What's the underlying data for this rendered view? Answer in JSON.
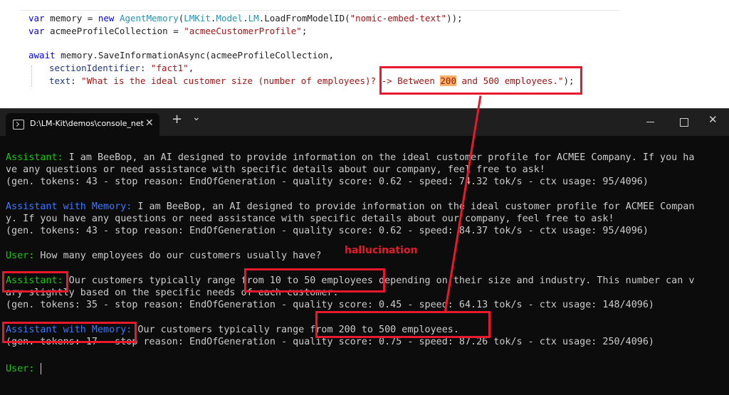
{
  "code": {
    "line1": {
      "p1": "var",
      "p2": " memory = ",
      "p3": "new",
      "p4": " ",
      "p5": "AgentMemory",
      "p6": "(",
      "p7": "LMKit",
      "p8": ".",
      "p9": "Model",
      "p10": ".",
      "p11": "LM",
      "p12": ".LoadFromModelID(",
      "p13": "\"nomic-embed-text\"",
      "p14": "));"
    },
    "line2": {
      "p1": "var",
      "p2": " acmeeProfileCollection = ",
      "p3": "\"acmeeCustomerProfile\"",
      "p4": ";"
    },
    "line3": {
      "p1": "await",
      "p2": " memory.SaveInformationAsync(acmeeProfileCollection,"
    },
    "line4": {
      "p1": "sectionIdentifier",
      "p2": ": ",
      "p3": "\"fact1\"",
      "p4": ","
    },
    "line5": {
      "p1": "text",
      "p2": ": ",
      "p3": "\"What is the ideal customer size (number of employees)? -> Between ",
      "p4": "200",
      "p5": " and 500 employees.\"",
      "p6": ");"
    }
  },
  "terminal": {
    "tab_title": "D:\\LM-Kit\\demos\\console_net",
    "tab_close": "✕",
    "new_tab": "+",
    "dropdown": "⌄",
    "window_close": "✕",
    "lines": {
      "l1a": "Assistant:",
      "l1b": " I am BeeBop, an AI designed to provide information on the ideal customer profile for ACMEE Company. If you ha",
      "l2": "ve any questions or need assistance with specific details about our company, feel free to ask!",
      "l3": "(gen. tokens: 43 - stop reason: EndOfGeneration - quality score: 0.62 - speed: 74.32 tok/s - ctx usage: 95/4096)",
      "l4a": "Assistant with Memory:",
      "l4b": " I am BeeBop, an AI designed to provide information on the ideal customer profile for ACMEE Compan",
      "l5": "y. If you have any questions or need assistance with specific details about our company, feel free to ask!",
      "l6": "(gen. tokens: 43 - stop reason: EndOfGeneration - quality score: 0.62 - speed: 84.37 tok/s - ctx usage: 95/4096)",
      "l7a": "User:",
      "l7b": " How many employees do our customers usually have?",
      "l8a": "Assistant:",
      "l8b": " Our customers typically range from 10 to 50 employees depending on their size and industry. This number can v",
      "l9": "ary slightly based on the specific needs of each customer.",
      "l10": "(gen. tokens: 35 - stop reason: EndOfGeneration - quality score: 0.45 - speed: 64.13 tok/s - ctx usage: 148/4096)",
      "l11a": "Assistant with Memory:",
      "l11b": " Our customers typically range from 200 to 500 employees.",
      "l12": "(gen. tokens: 17 - stop reason: EndOfGeneration - quality score: 0.75 - speed: 87.26 tok/s - ctx usage: 250/4096)",
      "l13a": "User:"
    }
  },
  "annotation": {
    "label": "hallucination"
  },
  "colors": {
    "annotation_red": "#e8192c",
    "terminal_green": "#16c60c",
    "terminal_blue": "#3b78ff",
    "terminal_bg": "#0c0c0c"
  }
}
